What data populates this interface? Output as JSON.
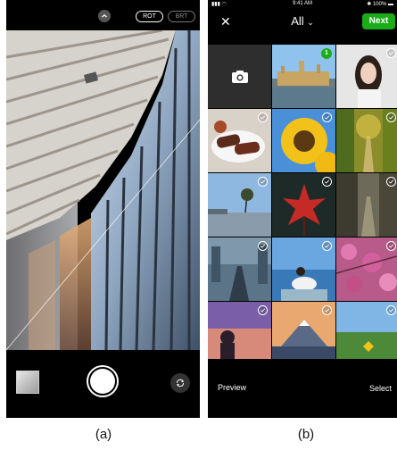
{
  "captions": {
    "a": "(a)",
    "b": "(b)"
  },
  "camera": {
    "toggle_rot": "ROT",
    "toggle_brt": "BRT",
    "icons": [
      "chevron-up-icon",
      "shutter-button",
      "flip-camera-icon"
    ]
  },
  "picker": {
    "status": {
      "time": "9:41 AM",
      "battery": "100%"
    },
    "album_title": "All",
    "next_label": "Next",
    "selected_count": "1",
    "preview_label": "Preview",
    "select_label": "Select",
    "colors": {
      "accent": "#1aad19",
      "background": "#000000"
    }
  }
}
